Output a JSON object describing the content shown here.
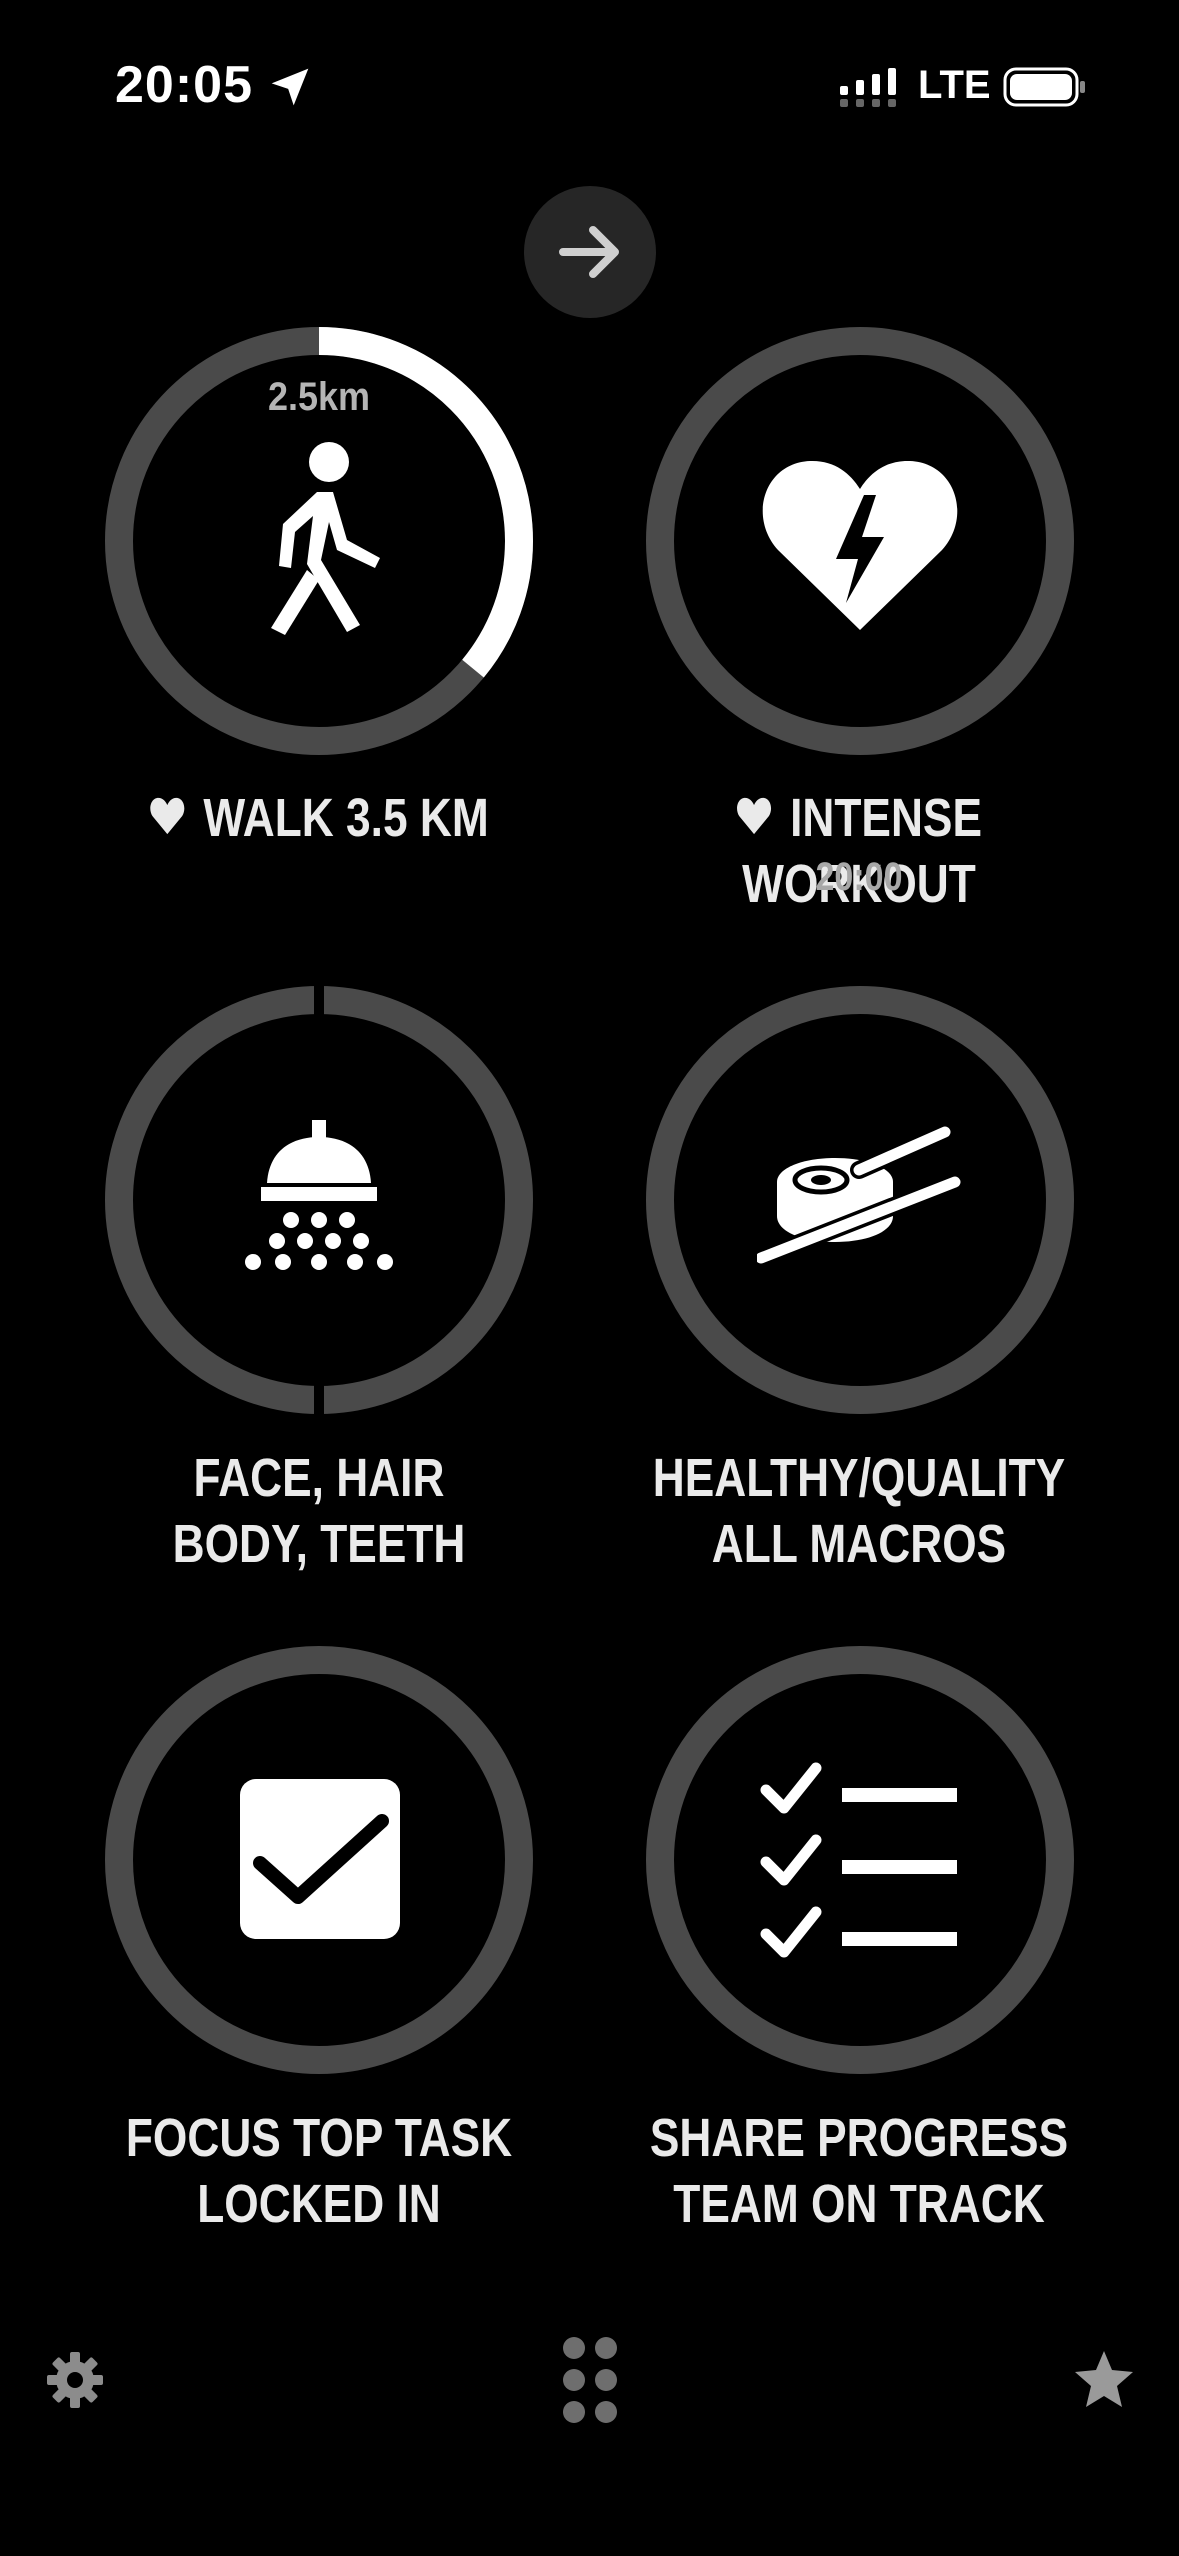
{
  "status_bar": {
    "time": "20:05",
    "network": "LTE",
    "icons": [
      "location-arrow-icon",
      "signal-bars-icon",
      "battery-icon"
    ]
  },
  "top": {
    "next_icon": "arrow-right-icon"
  },
  "habits": [
    {
      "lines": [
        "WALK 3.5 KM"
      ],
      "favorite": true,
      "progress_text": "2.5km",
      "progress_fraction": 0.36,
      "icon": "walking-person-icon"
    },
    {
      "lines": [
        "INTENSE WORKOUT"
      ],
      "favorite": true,
      "subtitle": "20:00",
      "progress_fraction": 0,
      "icon": "heart-bolt-icon"
    },
    {
      "lines": [
        "FACE, HAIR",
        "BODY, TEETH"
      ],
      "favorite": false,
      "progress_fraction": 0,
      "icon": "shower-icon"
    },
    {
      "lines": [
        "HEALTHY/QUALITY",
        "ALL MACROS"
      ],
      "favorite": false,
      "progress_fraction": 0,
      "icon": "sushi-chopsticks-icon"
    },
    {
      "lines": [
        "FOCUS TOP TASK",
        "LOCKED IN"
      ],
      "favorite": false,
      "progress_fraction": 0,
      "icon": "checkbox-icon"
    },
    {
      "lines": [
        "SHARE PROGRESS",
        "TEAM ON TRACK"
      ],
      "favorite": false,
      "progress_fraction": 0,
      "icon": "checklist-icon"
    }
  ],
  "bottom_bar": {
    "left_icon": "gear-icon",
    "center_icon": "grid-dots-icon",
    "right_icon": "star-icon"
  },
  "colors": {
    "background": "#000000",
    "ring_track": "#4a4a4a",
    "ring_progress": "#ffffff",
    "text": "#eaeaea",
    "muted": "#a8a8a8"
  }
}
